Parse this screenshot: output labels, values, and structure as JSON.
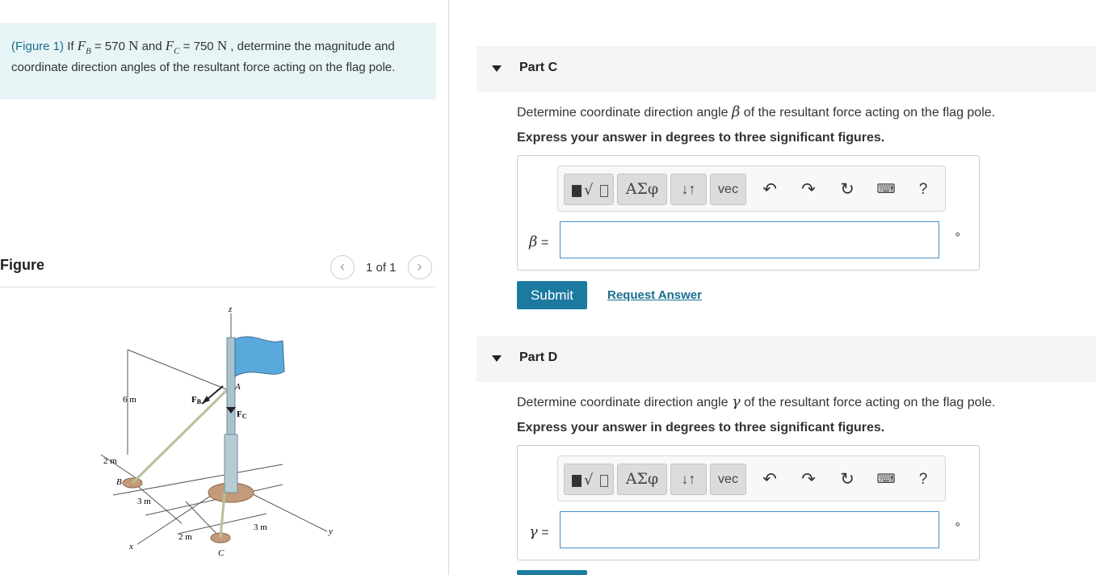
{
  "problem": {
    "figure_link": "(Figure 1)",
    "text_if": " If ",
    "fb_label": "F",
    "fb_sub": "B",
    "fb_value": " = 570 ",
    "fb_unit": "N",
    "text_and": " and ",
    "fc_label": "F",
    "fc_sub": "C",
    "fc_value": " = 750 ",
    "fc_unit": "N",
    "text_rest": " , determine the magnitude and coordinate direction angles of the resultant force acting on the flag pole."
  },
  "figure_panel": {
    "title": "Figure",
    "pager_text": "1 of 1",
    "prev_icon": "chevron-left-icon",
    "next_icon": "chevron-right-icon",
    "labels": {
      "z": "z",
      "y": "y",
      "x": "x",
      "a": "A",
      "b": "B",
      "c": "C",
      "fb": "F",
      "fb_sub": "B",
      "fc": "F",
      "fc_sub": "C",
      "h6": "6 m",
      "d2a": "2 m",
      "d3a": "3 m",
      "d2b": "2 m",
      "d3b": "3 m"
    },
    "flag_color": "#5aa9dd"
  },
  "part_c": {
    "title": "Part C",
    "question_pre": "Determine coordinate direction angle ",
    "symbol": "β",
    "question_post": " of the resultant force acting on the flag pole.",
    "instruction": "Express your answer in degrees to three significant figures.",
    "var_eq": " =",
    "unit": "∘",
    "input_value": "",
    "submit_label": "Submit",
    "request_label": "Request Answer"
  },
  "part_d": {
    "title": "Part D",
    "question_pre": "Determine coordinate direction angle ",
    "symbol": "γ",
    "question_post": " of the resultant force acting on the flag pole.",
    "instruction": "Express your answer in degrees to three significant figures.",
    "var_eq": " =",
    "unit": "∘",
    "input_value": ""
  },
  "toolbar": {
    "greek_label": "ΑΣφ",
    "arrows_label": "↓↑",
    "vec_label": "vec",
    "undo_icon": "undo-icon",
    "redo_icon": "redo-icon",
    "reset_icon": "reset-icon",
    "keyboard_icon": "keyboard-icon",
    "help_label": "?"
  },
  "colors": {
    "problem_bg": "#e8f5f6",
    "link": "#1a6e8f",
    "submit_bg": "#1c7aa0",
    "part_header_bg": "#f5f5f5",
    "input_border": "#4a90c8"
  }
}
